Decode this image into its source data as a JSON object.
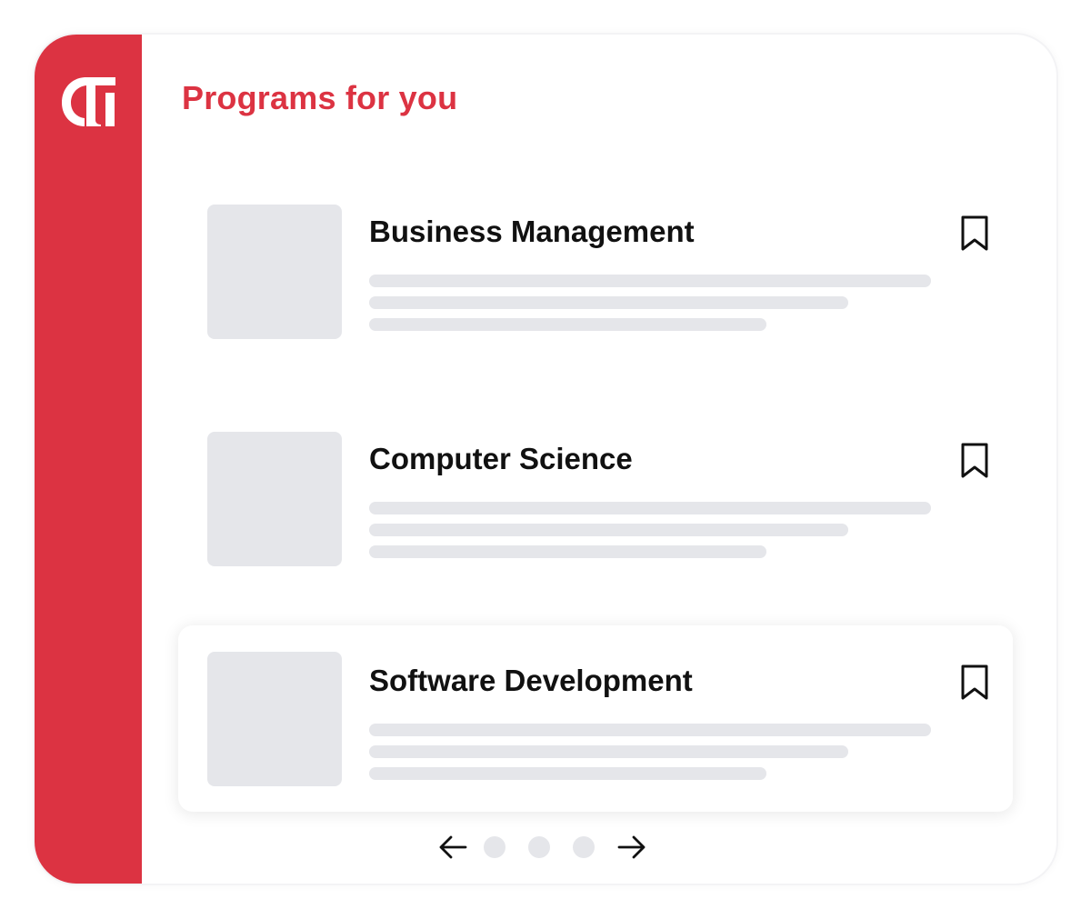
{
  "colors": {
    "brand_red": "#dc3342",
    "placeholder_gray": "#e5e6ea",
    "text_dark": "#111111",
    "icon_white": "#ffffff"
  },
  "sidebar": {
    "logo_icon": "brand-g-logo-icon"
  },
  "header": {
    "title": "Programs for you"
  },
  "programs": [
    {
      "title": "Business Management",
      "bookmark_icon": "bookmark-icon",
      "highlighted": false
    },
    {
      "title": "Computer Science",
      "bookmark_icon": "bookmark-icon",
      "highlighted": false
    },
    {
      "title": "Software Development",
      "bookmark_icon": "bookmark-icon",
      "highlighted": true
    }
  ],
  "pagination": {
    "prev_icon": "arrow-left-icon",
    "next_icon": "arrow-right-icon",
    "page_count": 3
  }
}
